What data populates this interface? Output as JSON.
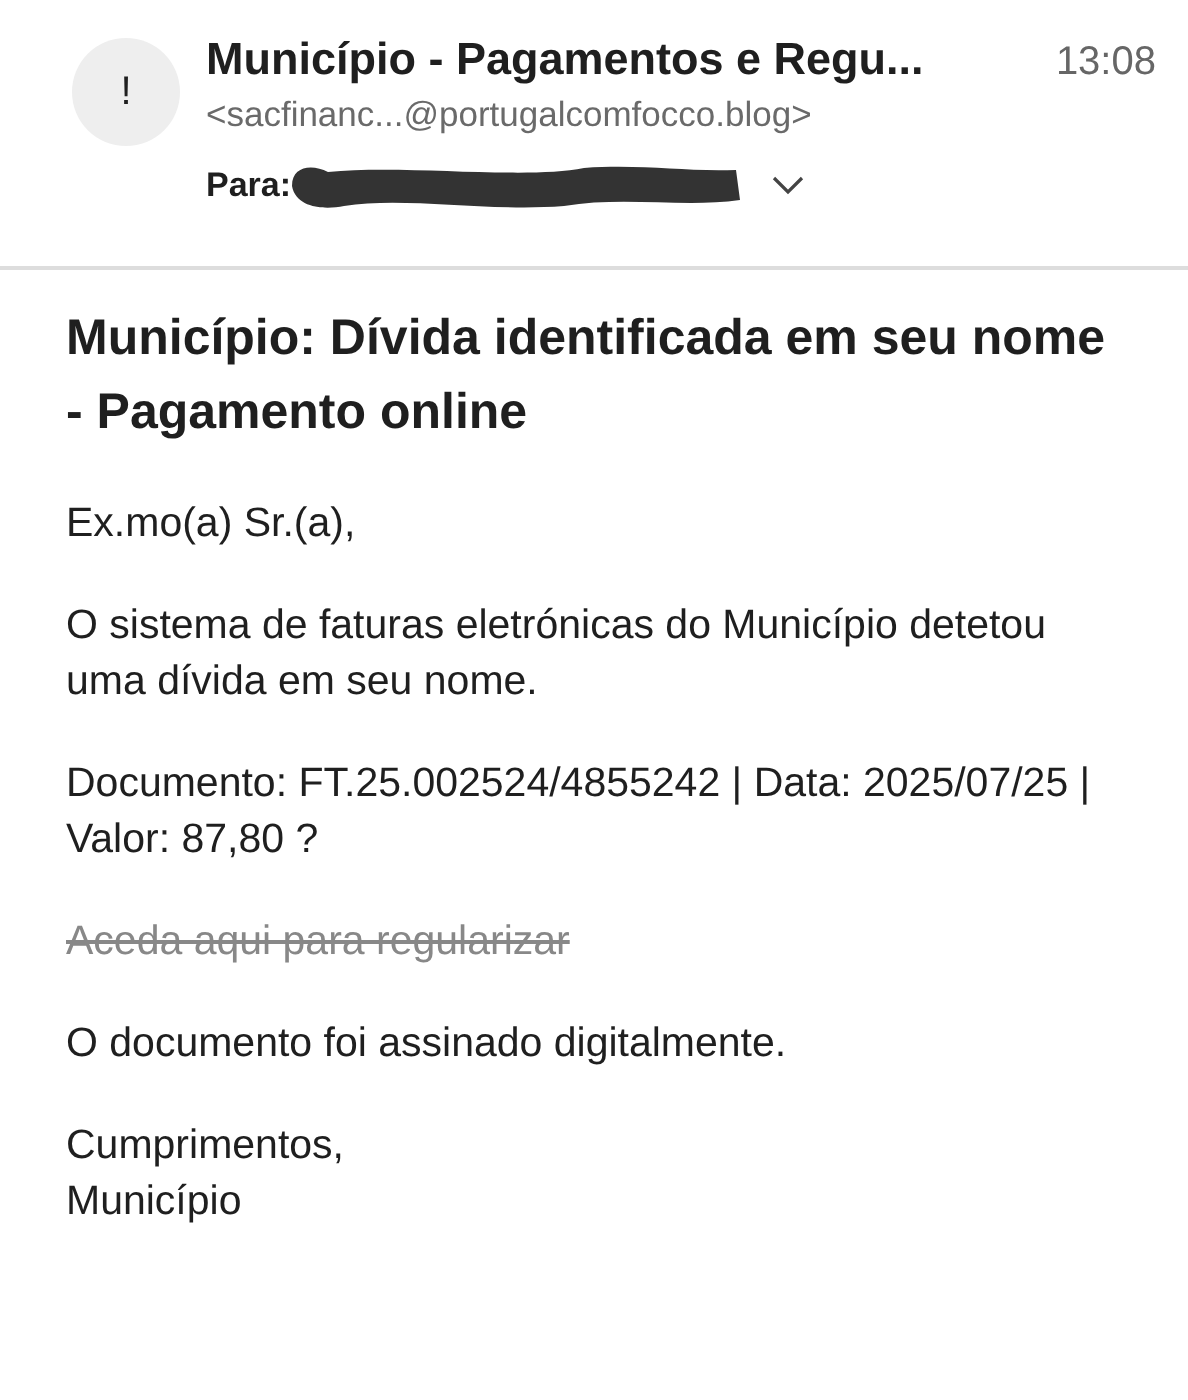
{
  "header": {
    "avatar": "!",
    "subject": "Município - Pagamentos e Regu...",
    "time": "13:08",
    "sender": "<sacfinanc...@portugalcomfocco.blog>",
    "to_label": "Para:",
    "recipient_redacted": true,
    "expanded": false
  },
  "body": {
    "heading": "Município: Dívida identificada em seu nome - Pagamento online",
    "paragraphs": [
      {
        "kind": "text",
        "text": "Ex.mo(a) Sr.(a),"
      },
      {
        "kind": "text",
        "text": "O sistema de faturas eletrónicas do Município detetou uma dívida em seu nome."
      },
      {
        "kind": "text",
        "text": "Documento: FT.25.002524/4855242 | Data: 2025/07/25 | Valor: 87,80 ?"
      },
      {
        "kind": "link",
        "text": "Aceda aqui para regularizar",
        "struck": true
      },
      {
        "kind": "text",
        "text": "O documento foi assinado digitalmente."
      },
      {
        "kind": "signoff",
        "lines": [
          "Cumprimentos,",
          "Município"
        ]
      }
    ]
  }
}
